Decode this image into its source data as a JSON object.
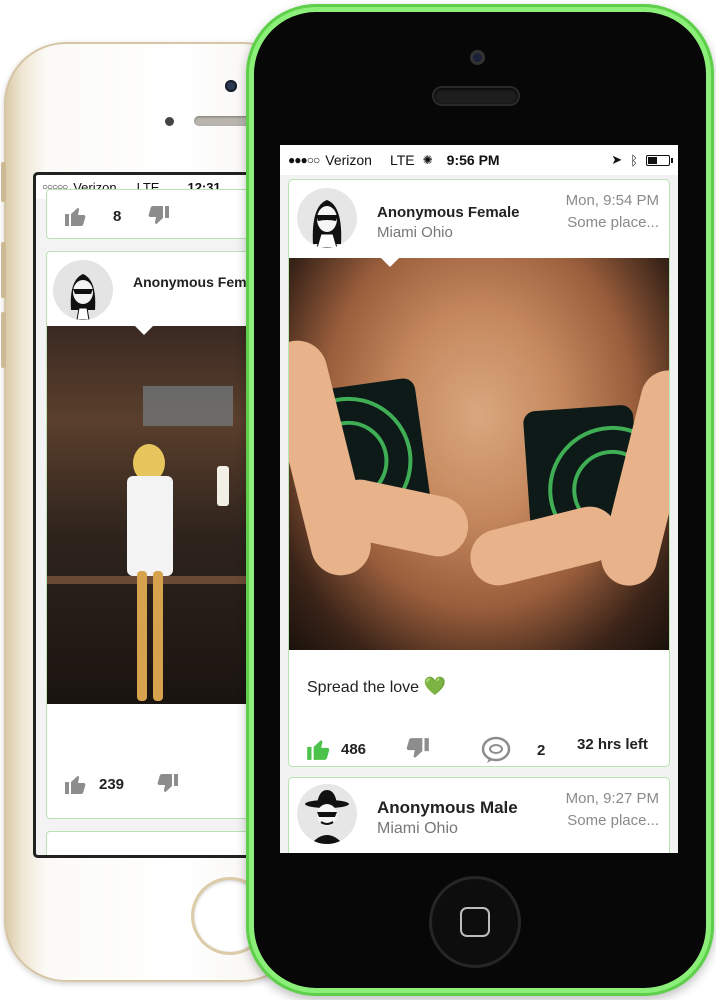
{
  "back_phone": {
    "status": {
      "carrier": "Verizon",
      "network": "LTE",
      "time": "12:31"
    },
    "card1": {
      "likes": "8"
    },
    "card2": {
      "name": "Anonymous Female",
      "likes": "239"
    }
  },
  "front_phone": {
    "status": {
      "signal": "●●●○○",
      "carrier": "Verizon",
      "network": "LTE",
      "time": "9:56 PM"
    },
    "post": {
      "name": "Anonymous Female",
      "location": "Miami Ohio",
      "date": "Mon, 9:54 PM",
      "place": "Some place...",
      "caption": "Spread the love",
      "caption_emoji": "💚",
      "likes": "486",
      "comments": "2",
      "time_left": "32 hrs left"
    },
    "post2": {
      "name": "Anonymous Male",
      "location": "Miami Ohio",
      "date": "Mon, 9:27 PM",
      "place": "Some place..."
    }
  },
  "colors": {
    "accent": "#4dc24a",
    "phone_green": "#7fe36a",
    "card_border": "#b9e3b2"
  }
}
